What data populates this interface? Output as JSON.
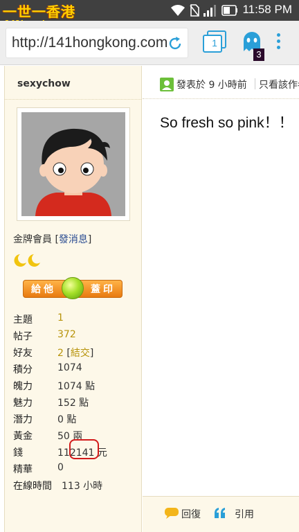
{
  "status_bar": {
    "logo_text": "一世一香港",
    "logo_url": "141hongkong.com",
    "time": "11:58 PM",
    "icons": [
      "wifi-icon",
      "no-sim-icon",
      "signal-icon",
      "battery-icon"
    ]
  },
  "browser": {
    "url": "http://141hongkong.com",
    "tab_count": "1",
    "ghost_badge": "3",
    "icons": [
      "reload-icon",
      "tabs-icon",
      "ghostery-icon",
      "overflow-menu-icon"
    ]
  },
  "user": {
    "name": "sexychow",
    "rank": "金牌會員",
    "message_link": "發消息",
    "stamp_left": "給他",
    "stamp_right": "蓋印",
    "stats": [
      {
        "label": "主題",
        "value": "1"
      },
      {
        "label": "帖子",
        "value": "372"
      },
      {
        "label": "好友",
        "value": "2",
        "extra": "結交"
      },
      {
        "label": "積分",
        "value": "1074"
      },
      {
        "label": "魄力",
        "value": "1074 點"
      },
      {
        "label": "魅力",
        "value": "152 點"
      },
      {
        "label": "潛力",
        "value": "0 點"
      },
      {
        "label": "黃金",
        "value": "50 兩"
      },
      {
        "label": "錢",
        "value": "112141 元"
      },
      {
        "label": "精華",
        "value": "0"
      },
      {
        "label": "在線時間",
        "value": "113 小時"
      }
    ]
  },
  "post": {
    "posted": "發表於 9 小時前",
    "only_author": "只看該作者",
    "body": "So fresh so pink！！",
    "reply": "回復",
    "quote": "引用"
  },
  "colors": {
    "status_bg": "#404040",
    "accent_blue": "#2a9fd8",
    "sidebar_bg": "#fdf8e9",
    "link_blue": "#2a4c91",
    "value_gold": "#b7930a",
    "highlight_red": "#d21a1a"
  }
}
